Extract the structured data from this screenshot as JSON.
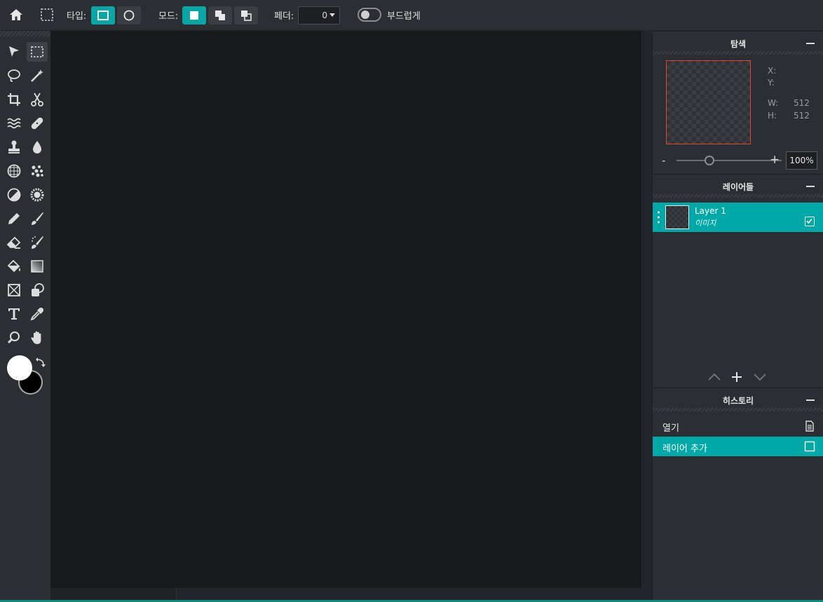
{
  "toolbar": {
    "type_label": "타입:",
    "mode_label": "모드:",
    "feather_label": "페더:",
    "feather_value": "0",
    "smooth_label": "부드럽게"
  },
  "navigator": {
    "title": "탐색",
    "x_label": "X:",
    "y_label": "Y:",
    "w_label": "W:",
    "h_label": "H:",
    "width": "512",
    "height": "512",
    "zoom_minus": "-",
    "zoom_plus": "+",
    "zoom_value": "100%"
  },
  "layers": {
    "title": "레이어들",
    "items": [
      {
        "name": "Layer 1",
        "type": "이미지",
        "visible": true
      }
    ]
  },
  "history": {
    "title": "히스토리",
    "items": [
      {
        "label": "열기"
      },
      {
        "label": "레이어 추가"
      }
    ]
  },
  "colors": {
    "accent": "#00a8a8",
    "foreground": "#ffffff",
    "background": "#000000"
  }
}
